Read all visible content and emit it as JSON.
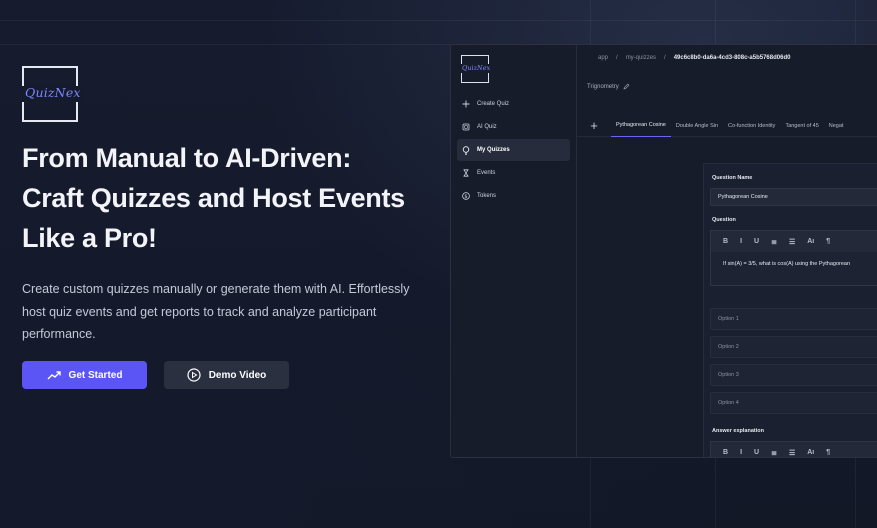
{
  "brand": {
    "logo_text": "QuizNex",
    "accent_color": "#5b55f5"
  },
  "hero": {
    "headline_lines": [
      "From Manual to AI-Driven:",
      "Craft Quizzes and Host Events",
      "Like a Pro!"
    ],
    "description_lines": [
      "Create custom quizzes manually or generate them with AI. Effortlessly",
      "host quiz events and get reports to track and analyze participant",
      "performance."
    ],
    "primary_button": {
      "label": "Get Started",
      "icon": "trending-up-icon"
    },
    "secondary_button": {
      "label": "Demo Video",
      "icon": "play-circle-icon"
    }
  },
  "app": {
    "sidebar": {
      "logo_text": "QuizNex",
      "items": [
        {
          "label": "Create Quiz",
          "icon": "plus-icon",
          "active": false
        },
        {
          "label": "AI Quiz",
          "icon": "chip-icon",
          "active": false
        },
        {
          "label": "My Quizzes",
          "icon": "lightbulb-icon",
          "active": true
        },
        {
          "label": "Events",
          "icon": "hourglass-icon",
          "active": false
        },
        {
          "label": "Tokens",
          "icon": "dollar-icon",
          "active": false
        }
      ]
    },
    "breadcrumb": [
      "app",
      "/",
      "my-quizzes",
      "/",
      "49c6c8b0-da6a-4cd3-808c-a5b5768d06d0"
    ],
    "quiz_title": "Trignometry",
    "tabs": [
      "Pythagorean Cosine",
      "Double Angle Sin",
      "Co-function Identity",
      "Tangent of 45",
      "Negat"
    ],
    "active_tab": 0,
    "editor": {
      "question_name_label": "Question Name",
      "question_name_value": "Pythagorean Cosine",
      "question_label": "Question",
      "toolbar": [
        "B",
        "I",
        "U",
        "≣",
        "☰",
        "Aı",
        "¶"
      ],
      "question_text": "If sin(A) = 3/5, what is cos(A) using the Pythagorean",
      "options": [
        "Option 1",
        "Option 2",
        "Option 3",
        "Option 4"
      ],
      "answer_label": "Answer explanation"
    }
  }
}
